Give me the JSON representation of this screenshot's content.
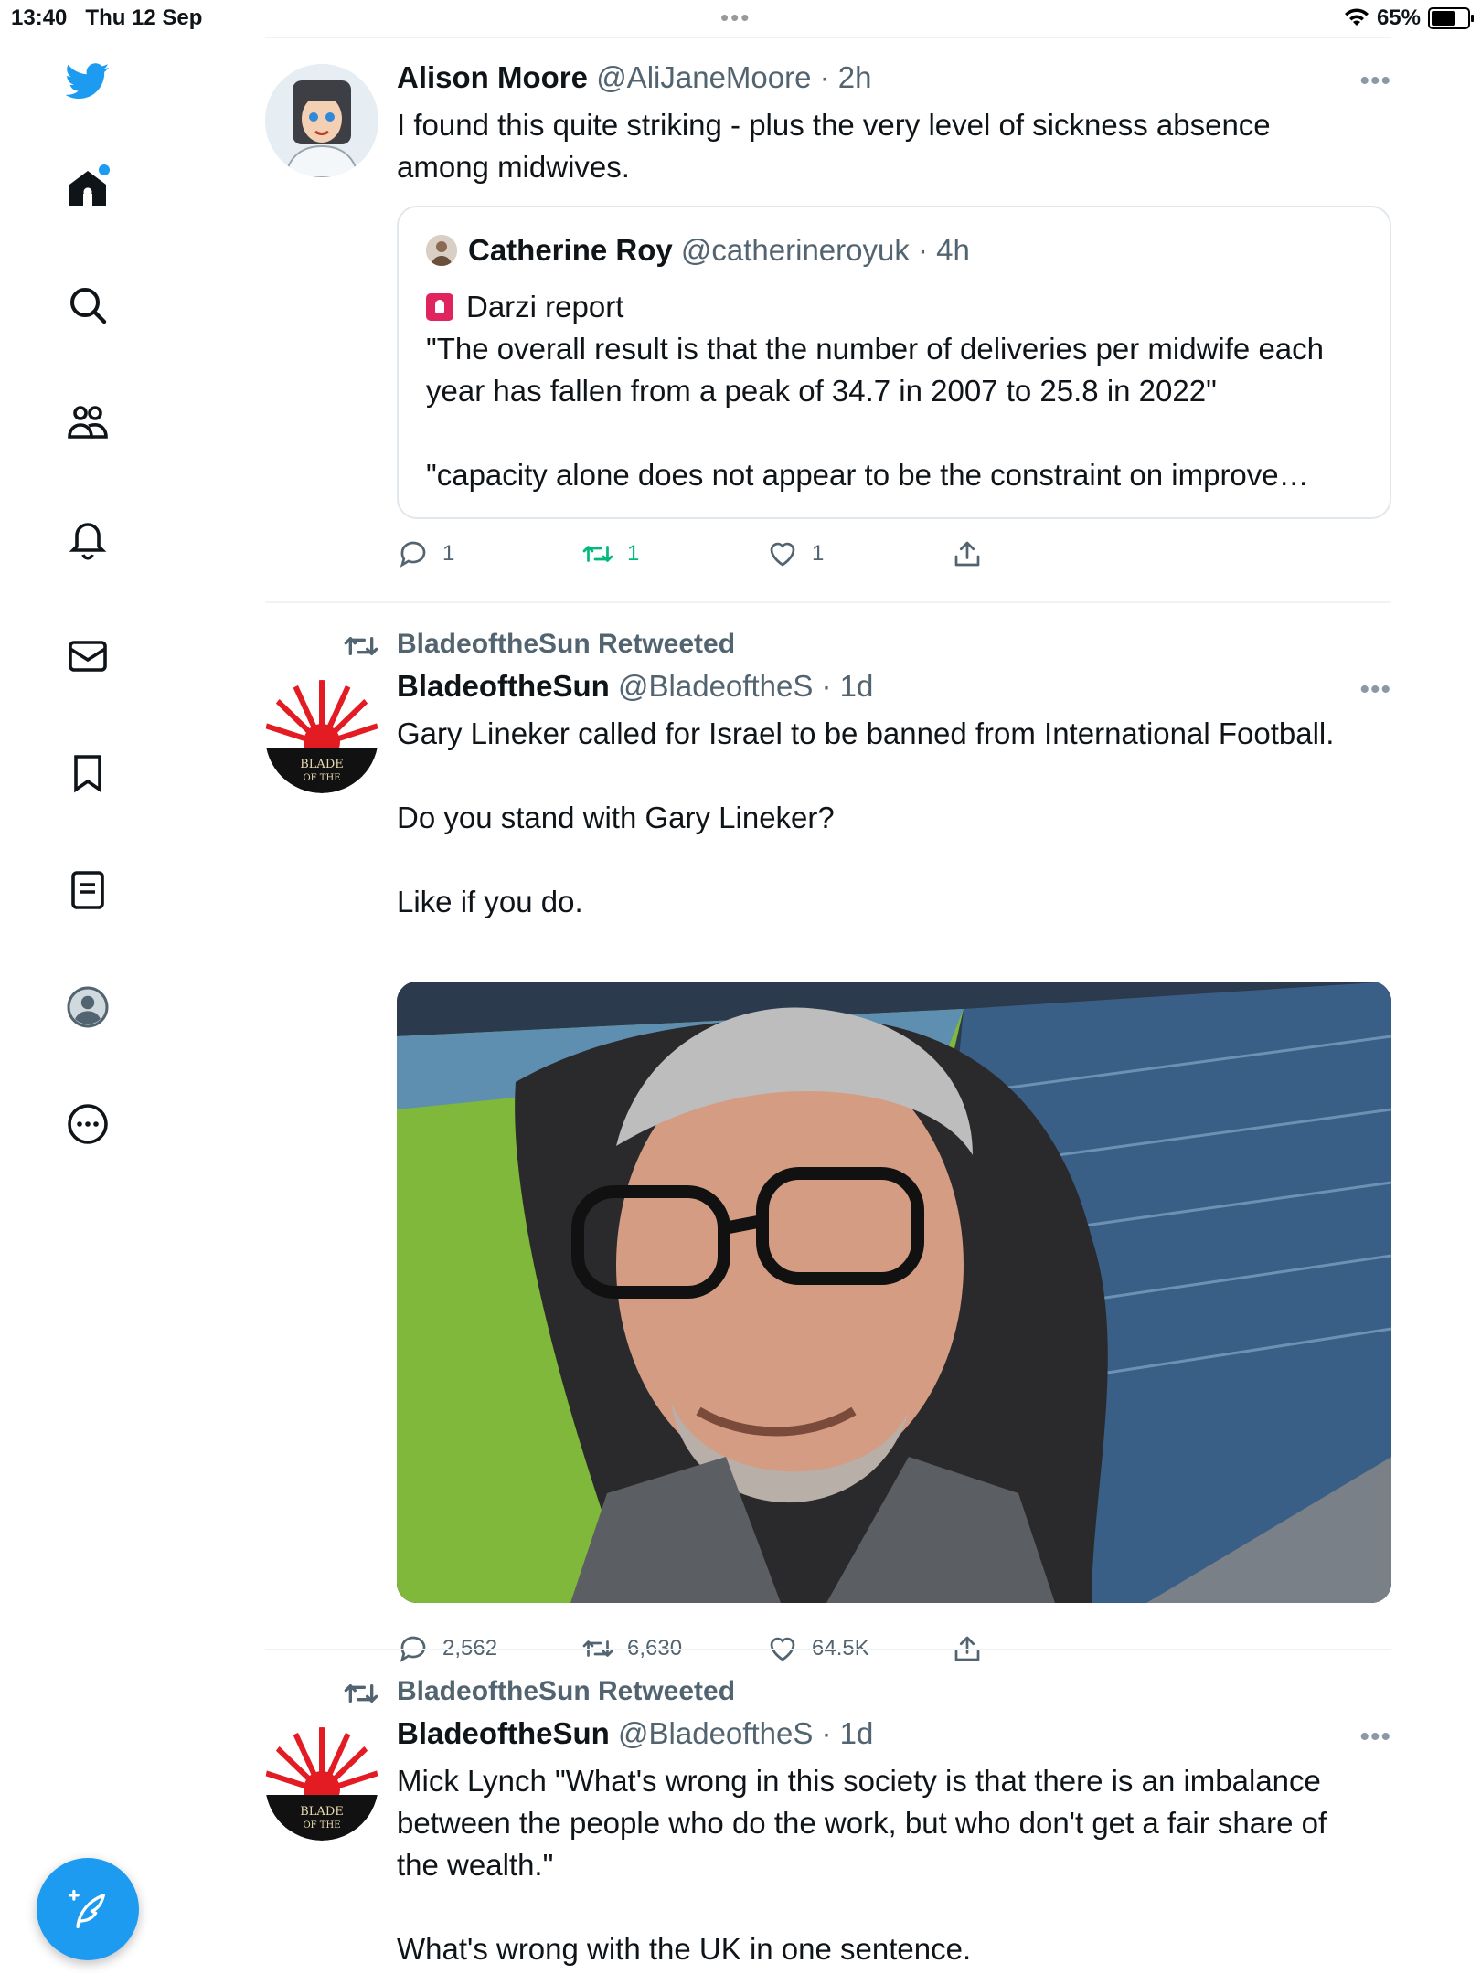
{
  "status_bar": {
    "time": "13:40",
    "date": "Thu 12 Sep",
    "battery": "65%"
  },
  "sidebar": {
    "items": [
      {
        "name": "home",
        "icon": "home-icon"
      },
      {
        "name": "explore",
        "icon": "search-icon"
      },
      {
        "name": "communities",
        "icon": "communities-icon"
      },
      {
        "name": "notifications",
        "icon": "bell-icon"
      },
      {
        "name": "messages",
        "icon": "mail-icon"
      },
      {
        "name": "bookmarks",
        "icon": "bookmark-icon"
      },
      {
        "name": "lists",
        "icon": "list-icon"
      },
      {
        "name": "profile",
        "icon": "profile-icon"
      },
      {
        "name": "more",
        "icon": "more-circle-icon"
      }
    ],
    "compose_icon": "compose-icon",
    "accent": "#1d9bf0"
  },
  "tweets": [
    {
      "name": "Alison Moore",
      "handle": "@AliJaneMoore",
      "time": "· 2h",
      "text": "I found this quite striking - plus the very level of sickness absence\namong midwives.",
      "quote": {
        "name": "Catherine Roy",
        "handle": "@catherineroyuk",
        "time": "· 4h",
        "title": "Darzi report",
        "text": "\"The overall result is that the number of deliveries per midwife each\nyear has fallen from a peak of 34.7 in 2007 to 25.8 in 2022\"\n\n\"capacity alone does not appear to be the constraint on improve…"
      },
      "replies": "1",
      "retweets": "1",
      "likes": "1"
    },
    {
      "retweeted_by": "BladeoftheSun Retweeted",
      "name": "BladeoftheSun",
      "handle": "@BladeoftheS",
      "time": "· 1d",
      "text": "Gary Lineker called for Israel to be banned from International Football.\n\nDo you stand with Gary Lineker?\n\nLike if you do.",
      "replies": "2,562",
      "retweets": "6,630",
      "likes": "64.5K"
    },
    {
      "retweeted_by": "BladeoftheSun Retweeted",
      "name": "BladeoftheSun",
      "handle": "@BladeoftheS",
      "time": "· 1d",
      "text": "Mick Lynch \"What's wrong in this society is that there is an imbalance\nbetween the people who do the work, but who don't get a fair share of\nthe wealth.\"\n\nWhat's wrong with the UK in one sentence."
    }
  ]
}
